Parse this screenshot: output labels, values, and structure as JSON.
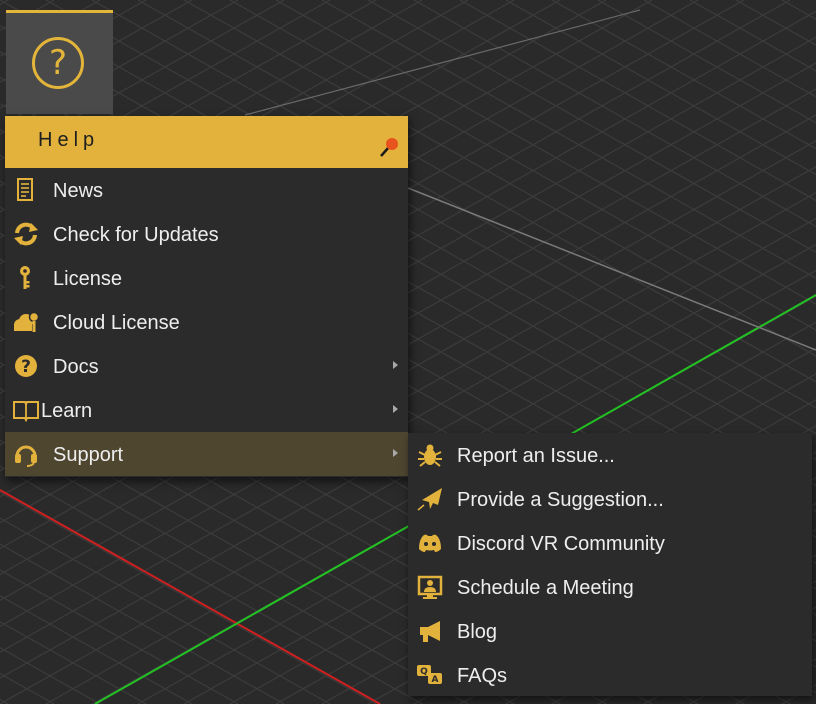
{
  "colors": {
    "accent": "#e2b23d",
    "menu_bg": "#2b2b2b",
    "highlight_bg": "#4f4630",
    "viewport_bg": "#2a2a2a",
    "grid_line": "#3e3e3e",
    "axis_red": "#d02020",
    "axis_green": "#20c020"
  },
  "toolbar": {
    "help_button_glyph": "?"
  },
  "help_menu": {
    "title": "Help",
    "items": [
      {
        "label": "News",
        "icon": "news-icon",
        "has_submenu": false
      },
      {
        "label": "Check for Updates",
        "icon": "refresh-icon",
        "has_submenu": false
      },
      {
        "label": "License",
        "icon": "key-icon",
        "has_submenu": false
      },
      {
        "label": "Cloud License",
        "icon": "cloud-key-icon",
        "has_submenu": false
      },
      {
        "label": "Docs",
        "icon": "question-icon",
        "has_submenu": true
      },
      {
        "label": "Learn",
        "icon": "book-icon",
        "has_submenu": true
      },
      {
        "label": "Support",
        "icon": "headset-icon",
        "has_submenu": true,
        "highlighted": true
      }
    ]
  },
  "support_submenu": {
    "items": [
      {
        "label": "Report an Issue...",
        "icon": "bug-icon"
      },
      {
        "label": "Provide a Suggestion...",
        "icon": "paper-plane-icon"
      },
      {
        "label": "Discord VR Community",
        "icon": "discord-icon"
      },
      {
        "label": "Schedule a Meeting",
        "icon": "meeting-icon"
      },
      {
        "label": "Blog",
        "icon": "megaphone-icon"
      },
      {
        "label": "FAQs",
        "icon": "faq-icon"
      }
    ]
  }
}
